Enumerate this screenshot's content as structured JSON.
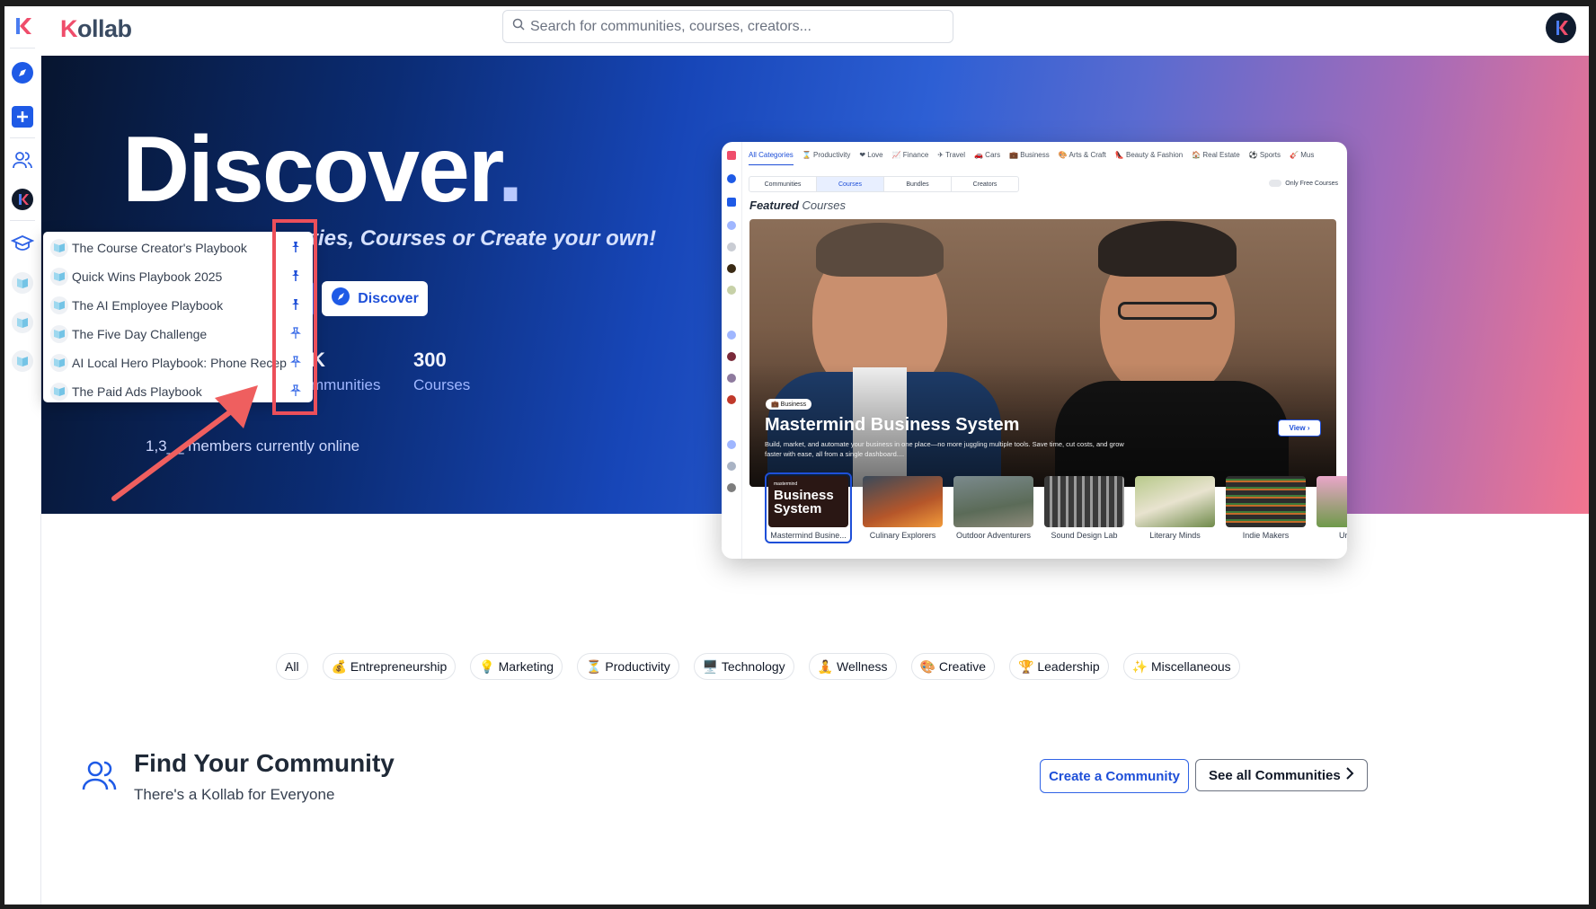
{
  "header": {
    "logo_text": "Kollab",
    "search_placeholder": "Search for communities, courses, creators..."
  },
  "hero": {
    "title": "Discover",
    "title_dot": ".",
    "subtitle": "ties, Courses or Create your own!",
    "discover_label": "Discover",
    "stats": [
      {
        "value": "K",
        "label": "mmunities"
      },
      {
        "value": "300",
        "label": "Courses"
      }
    ],
    "online": "1,3__ members currently online"
  },
  "dropdown": {
    "items": [
      {
        "label": "The Course Creator's Playbook",
        "pinned": true
      },
      {
        "label": "Quick Wins Playbook 2025",
        "pinned": true
      },
      {
        "label": "The AI Employee Playbook",
        "pinned": true
      },
      {
        "label": "The Five Day Challenge",
        "pinned": false
      },
      {
        "label": "AI Local Hero Playbook: Phone Recep...",
        "pinned": false
      },
      {
        "label": "The Paid Ads Playbook",
        "pinned": false
      }
    ]
  },
  "preview": {
    "categories": [
      "All Categories",
      "⌛ Productivity",
      "❤ Love",
      "📈 Finance",
      "✈ Travel",
      "🚗 Cars",
      "💼 Business",
      "🎨 Arts & Craft",
      "👠 Beauty & Fashion",
      "🏠 Real Estate",
      "⚽ Sports",
      "🎸 Mus"
    ],
    "tabs": [
      "Communities",
      "Courses",
      "Bundles",
      "Creators"
    ],
    "free_toggle": "Only Free Courses",
    "featured_bold": "Featured",
    "featured_rest": "Courses",
    "badge": "💼 Business",
    "banner_title": "Mastermind Business System",
    "banner_desc": "Build, market, and automate your business in one place—no more juggling multiple tools. Save time, cut costs, and grow faster with ease, all from a single dashboard....",
    "view_label": "View",
    "thumb_overlay_small": "mastermind",
    "thumb_overlay_big": "Business System",
    "thumbs": [
      "Mastermind Busine...",
      "Culinary Explorers",
      "Outdoor Adventurers",
      "Sound Design Lab",
      "Literary Minds",
      "Indie Makers",
      "Urban Ga"
    ]
  },
  "chips": [
    "All",
    "💰 Entrepreneurship",
    "💡 Marketing",
    "⏳ Productivity",
    "🖥️ Technology",
    "🧘 Wellness",
    "🎨 Creative",
    "🏆 Leadership",
    "✨ Miscellaneous"
  ],
  "community": {
    "title": "Find Your Community",
    "subtitle": "There's a Kollab for Everyone",
    "create_label": "Create a Community",
    "see_all_label": "See all Communities"
  },
  "colors": {
    "accent": "#1e4fd8",
    "highlight": "#ec4f5a",
    "brand_pink": "#ef4d6b"
  }
}
